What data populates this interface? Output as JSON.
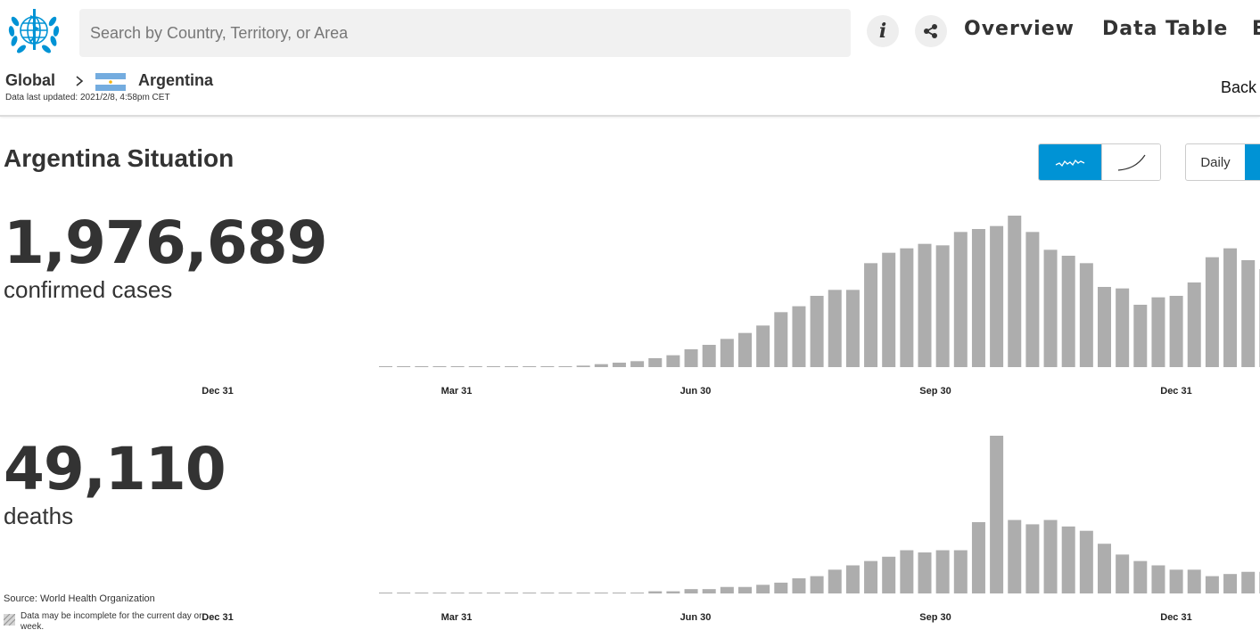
{
  "header": {
    "logo_text": "World Health Organization",
    "search_placeholder": "Search by Country, Territory, or Area",
    "info_icon": "info-icon",
    "share_icon": "share-icon",
    "nav": [
      {
        "label": "Overview"
      },
      {
        "label": "Data Table"
      },
      {
        "label": "E"
      }
    ]
  },
  "breadcrumb": {
    "root": "Global",
    "country": "Argentina",
    "flag_colors": [
      "#74acdf",
      "#ffffff",
      "#74acdf"
    ],
    "updated": "Data last updated: 2021/2/8, 4:58pm CET",
    "back": "Back"
  },
  "situation": {
    "title": "Argentina Situation",
    "controls": {
      "chart_mode_selected": "bars",
      "daily_label": "Daily",
      "accent": "#0093d5"
    },
    "cases": {
      "value": "1,976,689",
      "label": "confirmed cases"
    },
    "deaths": {
      "value": "49,110",
      "label": "deaths"
    }
  },
  "chart_data": [
    {
      "type": "bar",
      "name": "confirmed cases",
      "color": "#adadad",
      "x_ticks": [
        "Dec 31",
        "Mar 31",
        "Jun 30",
        "Sep 30",
        "Dec 31"
      ],
      "values": [
        0,
        0,
        0,
        0,
        0,
        0,
        0,
        0,
        0,
        0,
        0,
        1,
        2,
        3,
        4,
        6,
        8,
        12,
        15,
        19,
        23,
        28,
        37,
        41,
        48,
        52,
        52,
        70,
        77,
        80,
        83,
        82,
        91,
        93,
        95,
        102,
        91,
        79,
        75,
        70,
        54,
        53,
        42,
        47,
        48,
        57,
        74,
        80,
        72,
        66,
        61,
        2
      ]
    },
    {
      "type": "bar",
      "name": "deaths",
      "color": "#adadad",
      "x_ticks": [
        "Dec 31",
        "Mar 31",
        "Jun 30",
        "Sep 30",
        "Dec 31"
      ],
      "values": [
        0,
        0,
        0,
        0,
        0,
        0,
        0,
        0,
        0,
        0,
        0,
        0,
        0,
        0,
        0,
        1,
        1,
        2,
        2,
        3,
        3,
        4,
        5,
        7,
        8,
        11,
        13,
        15,
        17,
        20,
        19,
        20,
        20,
        33,
        73,
        34,
        32,
        34,
        31,
        29,
        23,
        18,
        15,
        13,
        11,
        11,
        8,
        9,
        10,
        10,
        14,
        13,
        13,
        2
      ]
    }
  ],
  "footer": {
    "source": "Source: World Health Organization",
    "note": "Data may be incomplete for the current day or week."
  }
}
